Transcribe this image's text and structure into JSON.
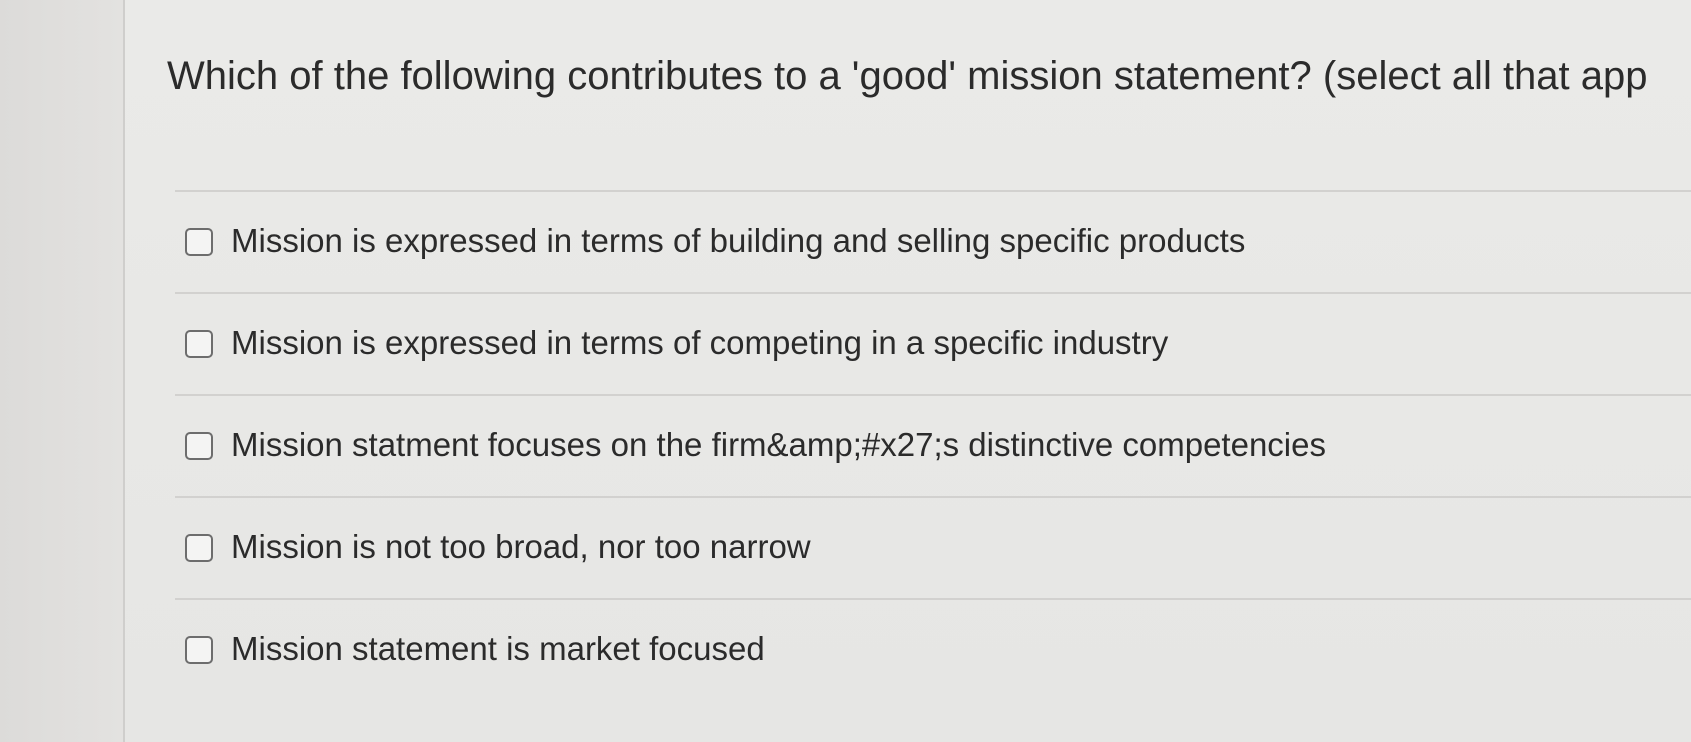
{
  "question": {
    "text": "Which of the following contributes to a 'good' mission statement? (select all that app"
  },
  "options": [
    {
      "label": "Mission is expressed in terms of building and selling specific products",
      "checked": false
    },
    {
      "label": "Mission is expressed in terms of competing in a specific industry",
      "checked": false
    },
    {
      "label": "Mission statment focuses on the firm&amp;#x27;s distinctive competencies",
      "checked": false
    },
    {
      "label": "Mission is not too broad, nor too narrow",
      "checked": false
    },
    {
      "label": "Mission statement is market focused",
      "checked": false
    }
  ]
}
